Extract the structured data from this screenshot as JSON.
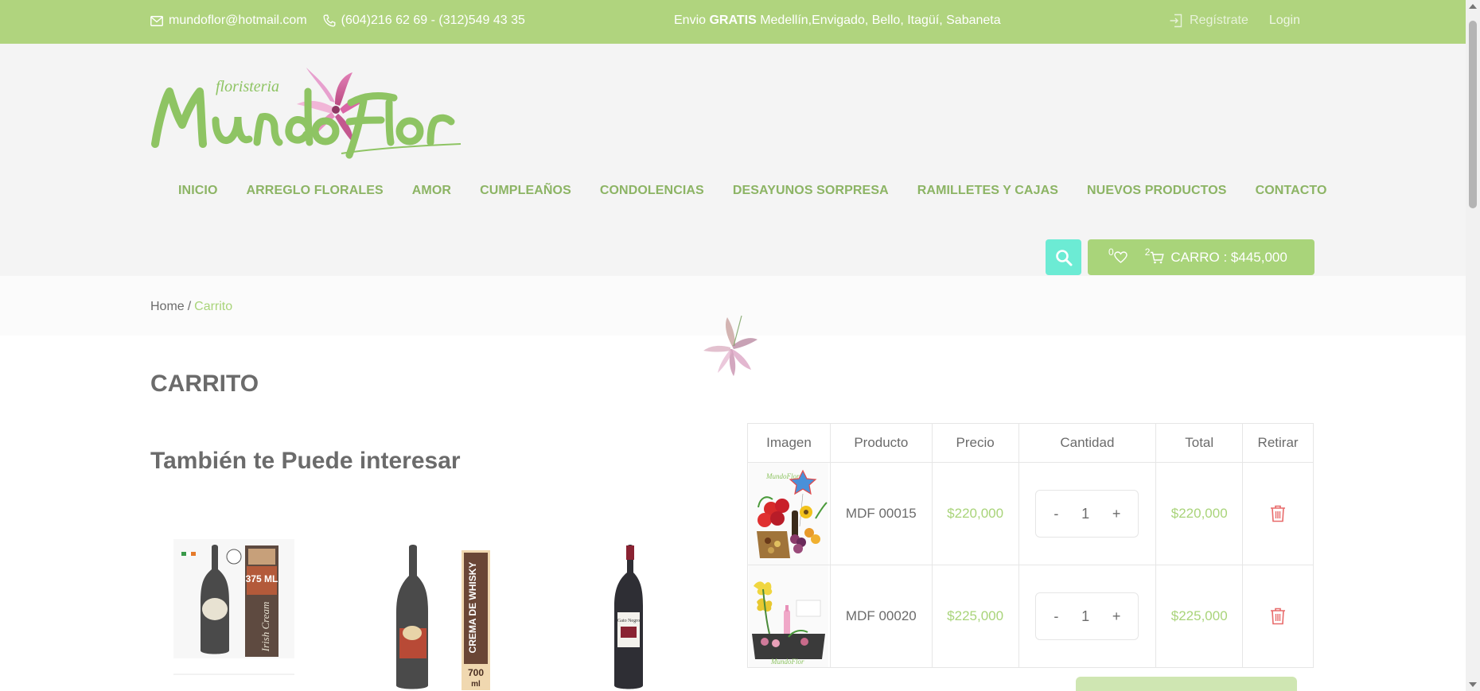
{
  "topbar": {
    "email": "mundoflor@hotmail.com",
    "phone": "(604)216 62 69 - (312)549 43 35",
    "shipping_prefix": "Envio",
    "shipping_bold": "GRATIS",
    "shipping_suffix": "Medellín,Envigado, Bello, Itagüí, Sabaneta",
    "register": "Regístrate",
    "login": "Login"
  },
  "nav": {
    "items": [
      {
        "label": "INICIO"
      },
      {
        "label": "ARREGLO FLORALES"
      },
      {
        "label": "AMOR"
      },
      {
        "label": "CUMPLEAÑOS"
      },
      {
        "label": "CONDOLENCIAS"
      },
      {
        "label": "DESAYUNOS SORPRESA"
      },
      {
        "label": "RAMILLETES Y CAJAS"
      },
      {
        "label": "NUEVOS PRODUCTOS"
      },
      {
        "label": "CONTACTO"
      }
    ]
  },
  "cart_button": {
    "wishlist_count": "0",
    "cart_count": "2",
    "label": "CARRO : $445,000"
  },
  "breadcrumb": {
    "home": "Home",
    "separator": "/",
    "current": "Carrito"
  },
  "page": {
    "title": "CARRITO",
    "related_title": "También te Puede interesar"
  },
  "cart_table": {
    "headers": [
      "Imagen",
      "Producto",
      "Precio",
      "Cantidad",
      "Total",
      "Retirar"
    ],
    "rows": [
      {
        "product": "MDF 00015",
        "price": "$220,000",
        "qty": "1",
        "total": "$220,000"
      },
      {
        "product": "MDF 00020",
        "price": "$225,000",
        "qty": "1",
        "total": "$225,000"
      }
    ],
    "minus": "-",
    "plus": "+"
  },
  "related_products": {
    "p1_badge": "375 ML",
    "p2_label": "CREMA DE WHISKY",
    "p2_volume": "700",
    "p2_unit": "ml"
  },
  "colors": {
    "brand_green": "#b0d47e",
    "nav_green": "#8cb464",
    "search_teal": "#6cebd4",
    "delete_red": "#e86a6a"
  }
}
